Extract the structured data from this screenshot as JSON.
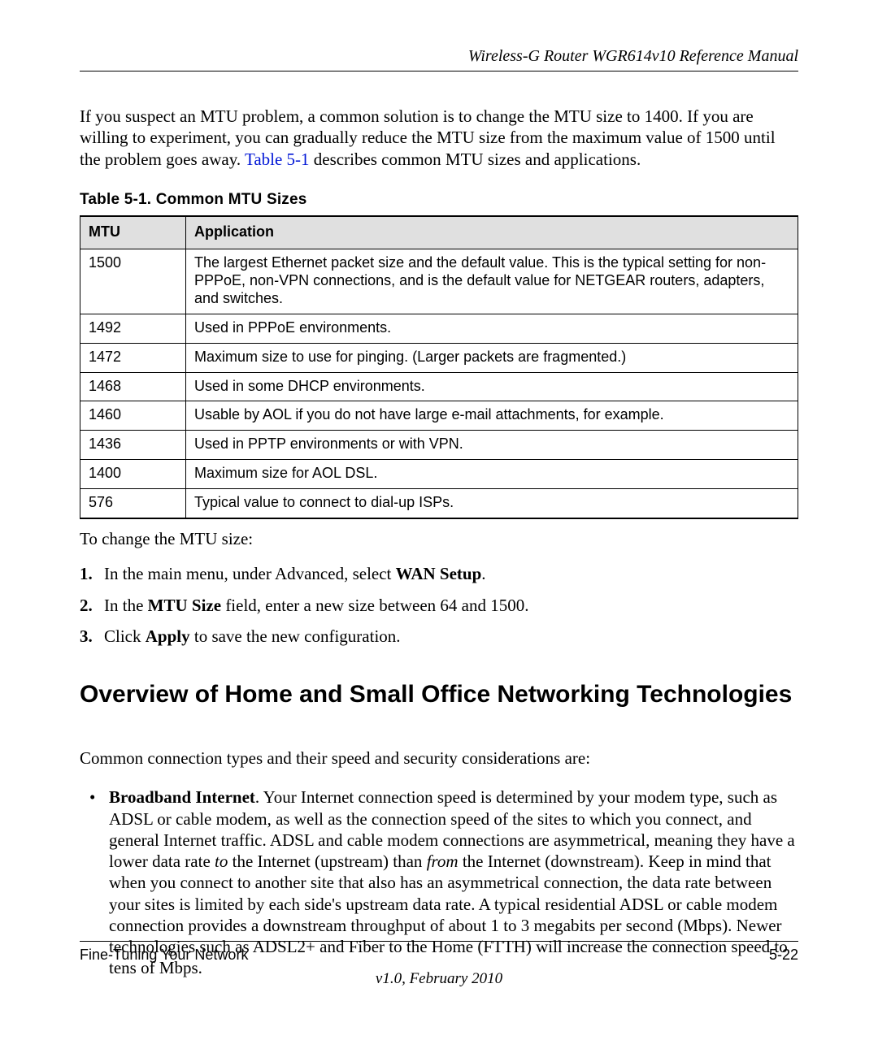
{
  "header": {
    "title": "Wireless-G Router WGR614v10 Reference Manual"
  },
  "intro": {
    "part1": "If you suspect an MTU problem, a common solution is to change the MTU size to 1400. If you are willing to experiment, you can gradually reduce the MTU size from the maximum value of 1500 until the problem goes away. ",
    "link": "Table 5-1",
    "part2": " describes common MTU sizes and applications."
  },
  "table": {
    "caption": "Table 5-1.  Common MTU Sizes",
    "headers": {
      "mtu": "MTU",
      "app": "Application"
    },
    "rows": [
      {
        "mtu": "1500",
        "app": "The largest Ethernet packet size and the default value. This is the typical setting for non-PPPoE, non-VPN connections, and is the default value for NETGEAR routers, adapters, and switches."
      },
      {
        "mtu": "1492",
        "app": "Used in PPPoE environments."
      },
      {
        "mtu": "1472",
        "app": "Maximum size to use for pinging. (Larger packets are fragmented.)"
      },
      {
        "mtu": "1468",
        "app": "Used in some DHCP environments."
      },
      {
        "mtu": "1460",
        "app": "Usable by AOL if you do not have large e-mail attachments, for example."
      },
      {
        "mtu": "1436",
        "app": "Used in PPTP environments or with VPN."
      },
      {
        "mtu": "1400",
        "app": "Maximum size for AOL DSL."
      },
      {
        "mtu": "576",
        "app": "Typical value to connect to dial-up ISPs."
      }
    ]
  },
  "afterTable": "To change the MTU size:",
  "steps": {
    "s1a": "In the main menu, under Advanced, select ",
    "s1b": "WAN Setup",
    "s1c": ".",
    "s2a": "In the ",
    "s2b": "MTU Size",
    "s2c": " field, enter a new size between 64 and 1500.",
    "s3a": "Click ",
    "s3b": "Apply",
    "s3c": " to save the new configuration."
  },
  "section": {
    "heading": "Overview of Home and Small Office Networking Technologies",
    "intro": "Common connection types and their speed and security considerations are:"
  },
  "bullet": {
    "b1_bold": "Broadband Internet",
    "b1_a": ". Your Internet connection speed is determined by your modem type, such as ADSL or cable modem, as well as the connection speed of the sites to which you connect, and general Internet traffic. ADSL and cable modem connections are asymmetrical, meaning they have a lower data rate ",
    "b1_to": "to",
    "b1_b": " the Internet (upstream) than ",
    "b1_from": "from",
    "b1_c": " the Internet (downstream). Keep in mind that when you connect to another site that also has an asymmetrical connection, the data rate between your sites is limited by each side's upstream data rate. A typical residential ADSL or cable modem connection provides a downstream throughput of about 1 to 3 megabits per second (Mbps). Newer technologies such as ADSL2+ and Fiber to the Home (FTTH) will increase the connection speed to tens of Mbps."
  },
  "footer": {
    "left": "Fine-Tuning Your Network",
    "right": "5-22",
    "version": "v1.0, February 2010"
  }
}
